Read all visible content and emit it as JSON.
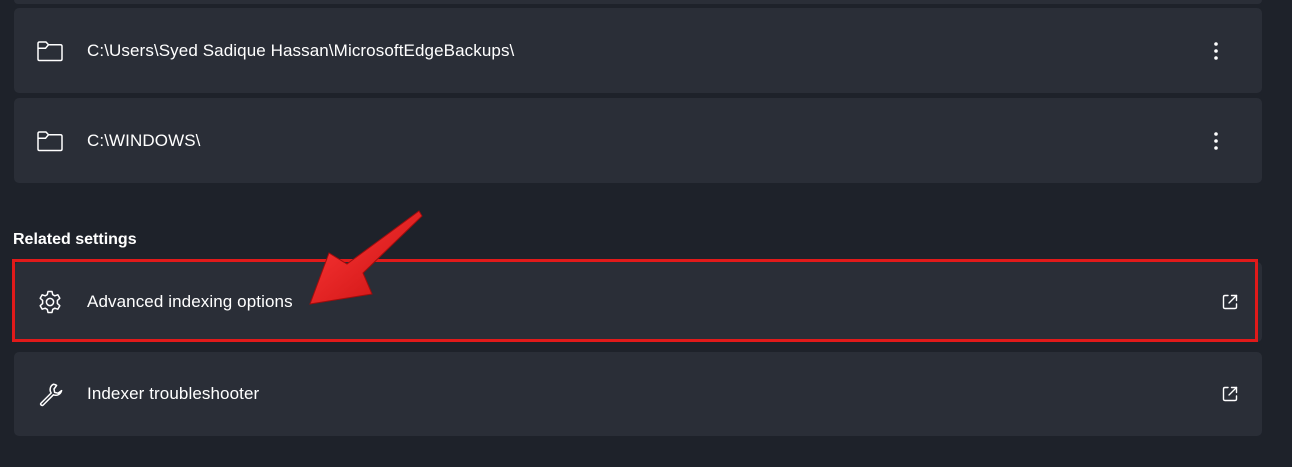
{
  "folders": [
    {
      "path": "C:\\Users\\Syed Sadique Hassan\\MicrosoftEdgeBackups\\",
      "icon": "folder-icon",
      "menu_icon": "more-options-icon"
    },
    {
      "path": "C:\\WINDOWS\\",
      "icon": "folder-icon",
      "menu_icon": "more-options-icon"
    }
  ],
  "related_settings": {
    "heading": "Related settings",
    "items": [
      {
        "label": "Advanced indexing options",
        "icon": "gear-icon",
        "action_icon": "open-external-icon"
      },
      {
        "label": "Indexer troubleshooter",
        "icon": "wrench-icon",
        "action_icon": "open-external-icon"
      }
    ]
  },
  "annotation": {
    "highlight_color": "#e11a1a",
    "arrow_color": "#e81c1c"
  },
  "colors": {
    "background": "#1e222a",
    "card": "#2a2e37",
    "text": "#ffffff"
  }
}
